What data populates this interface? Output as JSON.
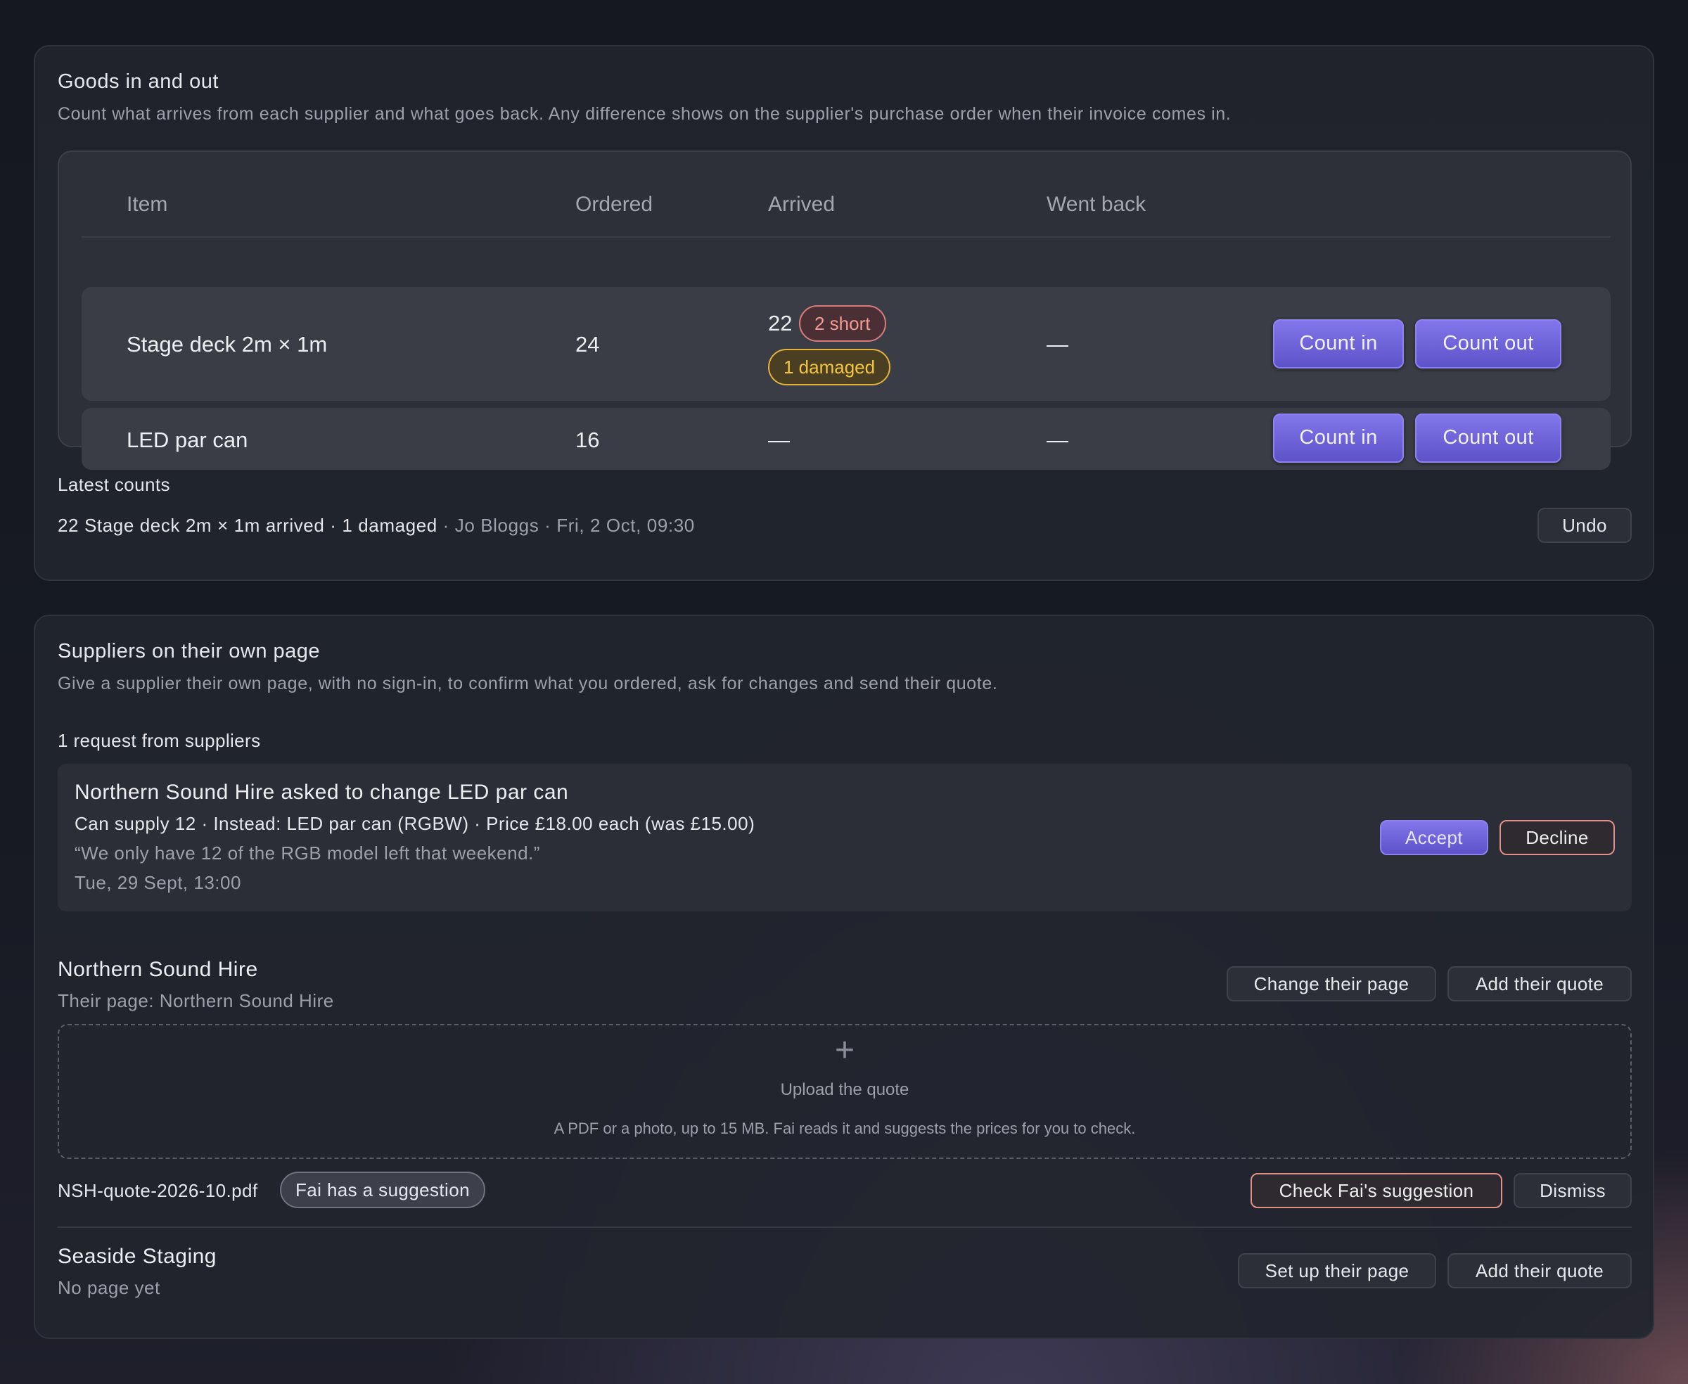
{
  "goods": {
    "title": "Goods in and out",
    "subtitle": "Count what arrives from each supplier and what goes back. Any difference shows on the supplier's purchase order when their invoice comes in.",
    "columns": {
      "item": "Item",
      "ordered": "Ordered",
      "arrived": "Arrived",
      "went_back": "Went back"
    },
    "rows": [
      {
        "item": "Stage deck 2m × 1m",
        "ordered": "24",
        "arrived": "22",
        "short_badge": "2 short",
        "damaged_badge": "1 damaged",
        "went_back": "—",
        "count_in": "Count in",
        "count_out": "Count out"
      },
      {
        "item": "LED par can",
        "ordered": "16",
        "arrived": "—",
        "went_back": "—",
        "count_in": "Count in",
        "count_out": "Count out"
      }
    ],
    "latest": {
      "heading": "Latest counts",
      "summary": "22 Stage deck 2m × 1m arrived · 1 damaged",
      "meta": " · Jo Bloggs · Fri, 2 Oct, 09:30",
      "undo": "Undo"
    }
  },
  "suppliers": {
    "title": "Suppliers on their own page",
    "subtitle": "Give a supplier their own page, with no sign-in, to confirm what you ordered, ask for changes and send their quote.",
    "requests_heading": "1 request from suppliers",
    "request": {
      "title": "Northern Sound Hire asked to change LED par can",
      "detail": "Can supply 12 · Instead: LED par can (RGBW) · Price £18.00 each (was £15.00)",
      "quote": "“We only have 12 of the RGB model left that weekend.”",
      "time": "Tue, 29 Sept, 13:00",
      "accept": "Accept",
      "decline": "Decline"
    },
    "list": [
      {
        "name": "Northern Sound Hire",
        "page_status": "Their page: Northern Sound Hire",
        "change_page": "Change their page",
        "add_quote": "Add their quote",
        "upload_icon": "+",
        "upload_title": "Upload the quote",
        "upload_hint": "A PDF or a photo, up to 15 MB. Fai reads it and suggests the prices for you to check.",
        "file_name": "NSH-quote-2026-10.pdf",
        "file_badge": "Fai has a suggestion",
        "check": "Check Fai's suggestion",
        "dismiss": "Dismiss"
      },
      {
        "name": "Seaside Staging",
        "page_status": "No page yet",
        "setup_page": "Set up their page",
        "add_quote": "Add their quote"
      }
    ]
  },
  "colors": {
    "accent": "#6b60d8",
    "danger_border": "#e09089",
    "warning": "#f4c542",
    "error_text": "#f39a94"
  }
}
